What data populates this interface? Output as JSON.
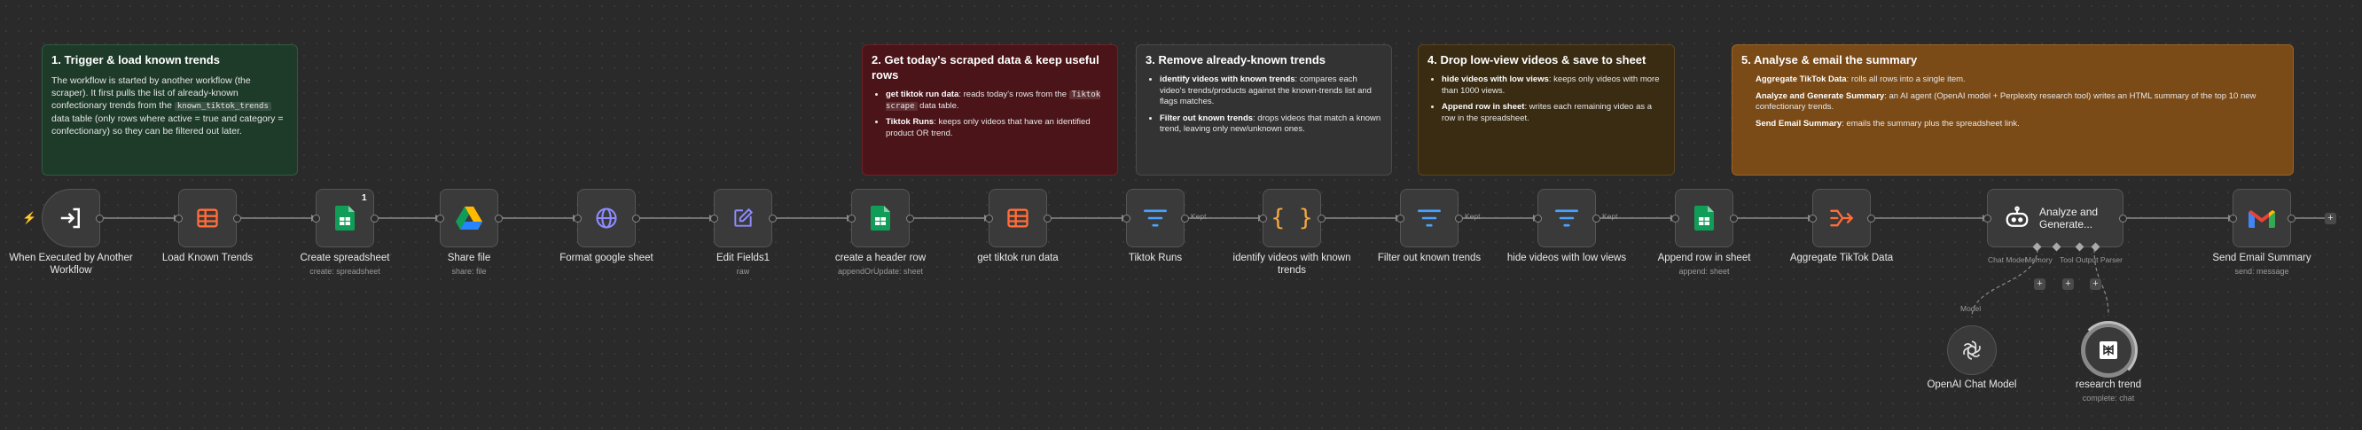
{
  "notes": {
    "n1": {
      "title": "1. Trigger & load known trends",
      "body_a": "The workflow is started by another workflow (the scraper). It first pulls the list of already-known confectionary trends from the",
      "body_code": "known_tiktok_trends",
      "body_b": " data table (only rows where active = true and category = confectionary) so they can be filtered out later.",
      "color": "#1f3a2a"
    },
    "n2": {
      "title": "2. Get today's scraped data & keep useful rows",
      "b1_bold": "get tiktok run data",
      "b1_text": ": reads today's rows from the ",
      "b1_code": "Tiktok scrape",
      "b1_tail": " data table.",
      "b2_bold": "Tiktok Runs",
      "b2_text": ": keeps only videos that have an identified product OR trend.",
      "color": "#4a1316"
    },
    "n3": {
      "title": "3. Remove already-known trends",
      "b1_bold": "identify videos with known trends",
      "b1_text": ": compares each video's trends/products against the known-trends list and flags matches.",
      "b2_bold": "Filter out known trends",
      "b2_text": ": drops videos that match a known trend, leaving only new/unknown ones.",
      "color": "#333333"
    },
    "n4": {
      "title": "4. Drop low-view videos & save to sheet",
      "b1_bold": "hide videos with low views",
      "b1_text": ": keeps only videos with more than 1000 views.",
      "b2_bold": "Append row in sheet",
      "b2_text": ": writes each remaining video as a row in the spreadsheet.",
      "color": "#3a2c12"
    },
    "n5": {
      "title": "5. Analyse & email the summary",
      "b1_bold": "Aggregate TikTok Data",
      "b1_text": ": rolls all rows into a single item.",
      "b2_bold": "Analyze and Generate Summary",
      "b2_text": ": an AI agent (OpenAI model + Perplexity research tool) writes an HTML summary of the top 10 new confectionary trends.",
      "b3_bold": "Send Email Summary",
      "b3_text": ": emails the summary plus the spreadsheet link.",
      "color": "#7a4a17"
    }
  },
  "nodes": {
    "trigger": {
      "label": "When Executed by Another Workflow",
      "icon": "workflow-entry-icon"
    },
    "load_known": {
      "label": "Load Known Trends",
      "icon": "table-icon"
    },
    "create_sheet": {
      "label": "Create spreadsheet",
      "sub": "create: spreadsheet",
      "icon": "google-sheets-icon",
      "badge": "1"
    },
    "share_file": {
      "label": "Share file",
      "sub": "share: file",
      "icon": "google-drive-icon"
    },
    "format_sheet": {
      "label": "Format google sheet",
      "icon": "globe-icon"
    },
    "edit_fields": {
      "label": "Edit Fields1",
      "sub": "raw",
      "icon": "edit-icon"
    },
    "header_row": {
      "label": "create a header row",
      "sub": "appendOrUpdate: sheet",
      "icon": "google-sheets-icon"
    },
    "get_run": {
      "label": "get tiktok run data",
      "icon": "table-icon"
    },
    "tiktok_runs": {
      "label": "Tiktok Runs",
      "branch": "Kept",
      "icon": "filter-icon"
    },
    "identify": {
      "label": "identify videos with known trends",
      "icon": "code-icon"
    },
    "filter_known": {
      "label": "Filter out known trends",
      "branch": "Kept",
      "icon": "filter-icon"
    },
    "hide_low": {
      "label": "hide videos with low views",
      "branch": "Kept",
      "icon": "filter-icon"
    },
    "append_row": {
      "label": "Append row in sheet",
      "sub": "append: sheet",
      "icon": "google-sheets-icon"
    },
    "aggregate": {
      "label": "Aggregate TikTok Data",
      "icon": "aggregate-icon"
    },
    "agent": {
      "label": "Analyze and Generate...",
      "icon": "robot-icon",
      "ports": [
        "Chat Model",
        "Memory",
        "Tool",
        "Output Parser"
      ]
    },
    "send_email": {
      "label": "Send Email Summary",
      "sub": "send: message",
      "icon": "gmail-icon"
    },
    "openai": {
      "label": "OpenAI Chat Model",
      "port": "Model",
      "icon": "openai-icon"
    },
    "research": {
      "label": "research trend",
      "sub": "complete: chat",
      "icon": "perplexity-icon"
    }
  },
  "controls": {
    "add": "+"
  }
}
